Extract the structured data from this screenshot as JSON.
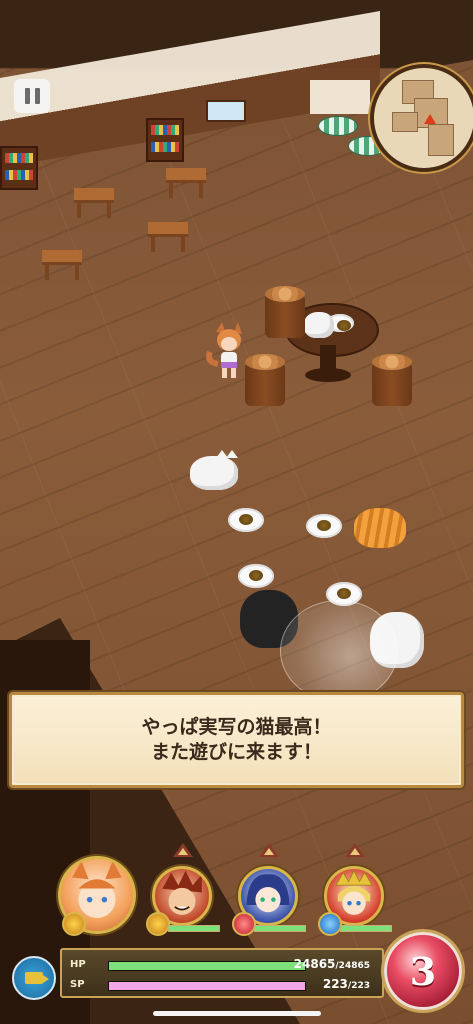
{
  "dialog": {
    "line1": "やっぱ実写の猫最高！",
    "line2": "また遊びに来ます！"
  },
  "controls": {
    "pause_icon": "pause-icon",
    "camera_icon": "camera-icon"
  },
  "status": {
    "hp_label": "HP",
    "hp_current": "24865",
    "hp_max": "/24865",
    "hp_fraction": 1.0,
    "sp_label": "SP",
    "sp_current": "223",
    "sp_max": "/223",
    "sp_fraction": 1.0
  },
  "special": {
    "count": "3"
  },
  "party": [
    {
      "name": "party-member-1",
      "health_fraction": 1.0
    },
    {
      "name": "party-member-2",
      "health_fraction": 1.0
    },
    {
      "name": "party-member-3",
      "health_fraction": 1.0
    },
    {
      "name": "party-member-4",
      "health_fraction": 1.0
    }
  ],
  "colors": {
    "hp_bar": "#7ee07a",
    "sp_bar": "#f2a6e8",
    "dialog_border": "#b8893f"
  }
}
